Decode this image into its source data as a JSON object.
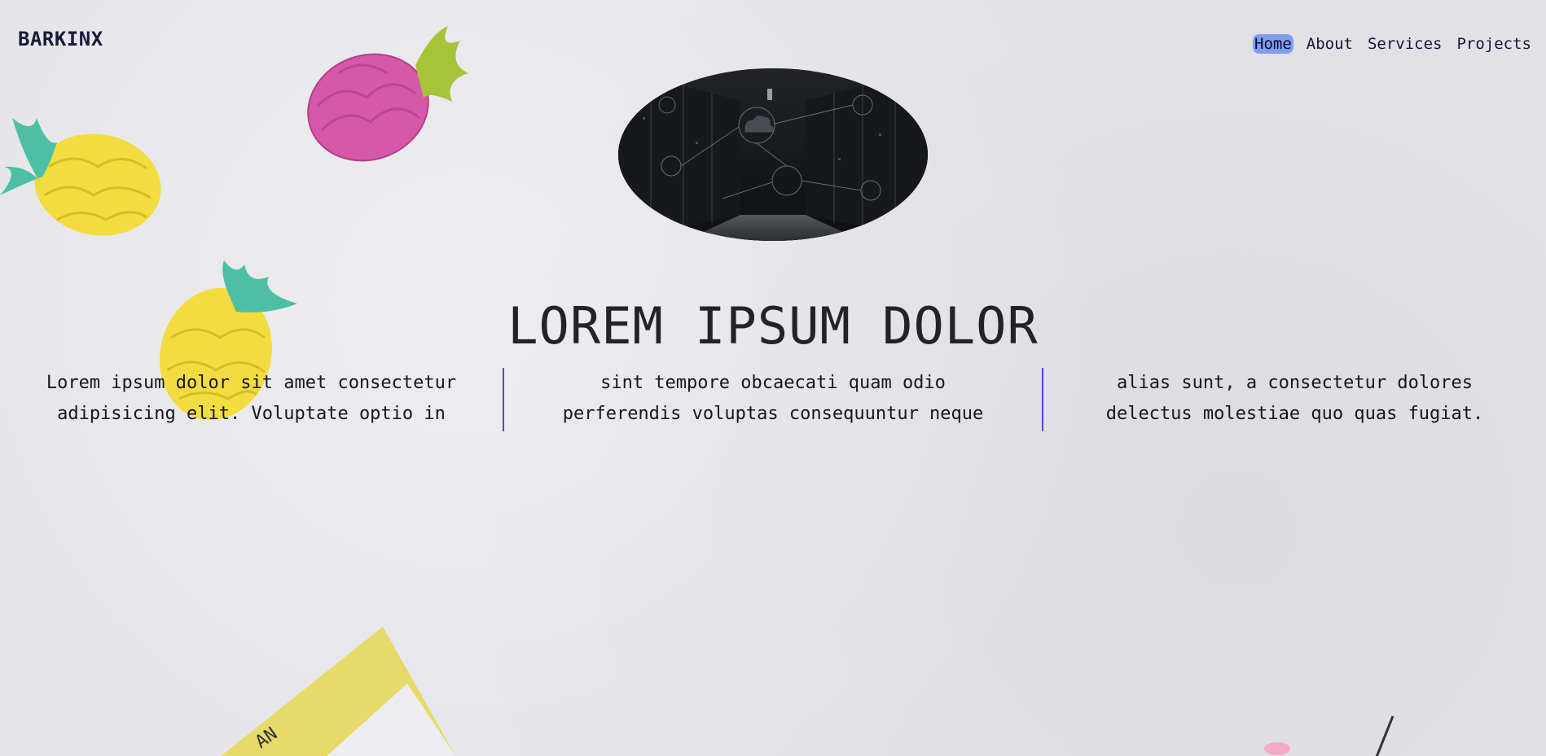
{
  "header": {
    "brand": "BARKINX",
    "nav": [
      {
        "label": "Home",
        "active": true
      },
      {
        "label": "About",
        "active": false
      },
      {
        "label": "Services",
        "active": false
      },
      {
        "label": "Projects",
        "active": false
      }
    ]
  },
  "hero": {
    "image_alt": "server room with cloud network icons",
    "headline": "LOREM IPSUM DOLOR"
  },
  "columns": [
    {
      "line1": "Lorem ipsum dolor sit amet consectetur",
      "line2": "adipisicing elit. Voluptate optio in"
    },
    {
      "line1": "sint tempore obcaecati quam odio",
      "line2": "perferendis voluptas consequuntur neque"
    },
    {
      "line1": "alias sunt, a consectetur dolores",
      "line2": "delectus molestiae quo quas fugiat."
    }
  ],
  "colors": {
    "nav_active_bg": "#7e9ef0",
    "divider": "#4b4bd8",
    "background": "#e4e4e8"
  }
}
